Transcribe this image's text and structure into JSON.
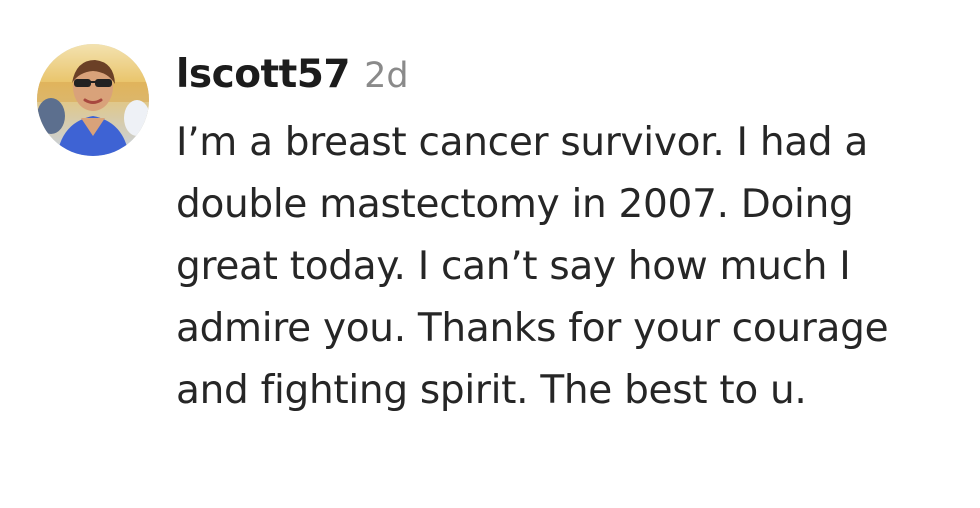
{
  "comment": {
    "avatar_icon": "user-photo-avatar",
    "username": "lscott57",
    "timestamp": "2d",
    "text": "I’m a breast cancer survivor. I had a double mastectomy in 2007. Doing great today. I can’t say how much I admire you. Thanks for your courage and fighting spirit. The best to u."
  },
  "colors": {
    "username": "#1c1c1c",
    "timestamp": "#8a8a8a",
    "body_text": "#262626",
    "background": "#ffffff"
  }
}
